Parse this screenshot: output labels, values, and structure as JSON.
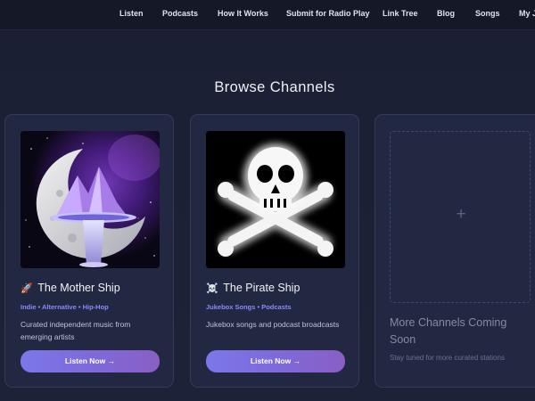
{
  "nav": {
    "items": [
      "Listen",
      "Podcasts",
      "How It Works",
      "Submit for Radio Play",
      "Link Tree",
      "Blog",
      "Songs",
      "My J"
    ]
  },
  "main": {
    "heading": "Browse Channels",
    "channels": [
      {
        "emoji": "🚀",
        "title": "The Mother Ship",
        "tags": "Indie • Alternative • Hip-Hop",
        "description": "Curated independent music from emerging artists",
        "button": "Listen Now →"
      },
      {
        "emoji": "☠️",
        "title": "The Pirate Ship",
        "tags": "Jukebox Songs • Podcasts",
        "description": "Jukebox songs and podcast broadcasts",
        "button": "Listen Now →"
      }
    ],
    "placeholder": {
      "plus": "+",
      "title": "More Channels Coming Soon",
      "description": "Stay tuned for more curated stations"
    }
  },
  "colors": {
    "background": "#1a1d2e",
    "card": "#232842",
    "accent_tag": "#8d87ff",
    "button_gradient_start": "#7b77ea",
    "button_gradient_end": "#8a5fc5"
  },
  "icons": [
    "rocket-icon",
    "skull-crossbones-icon",
    "plus-icon"
  ]
}
